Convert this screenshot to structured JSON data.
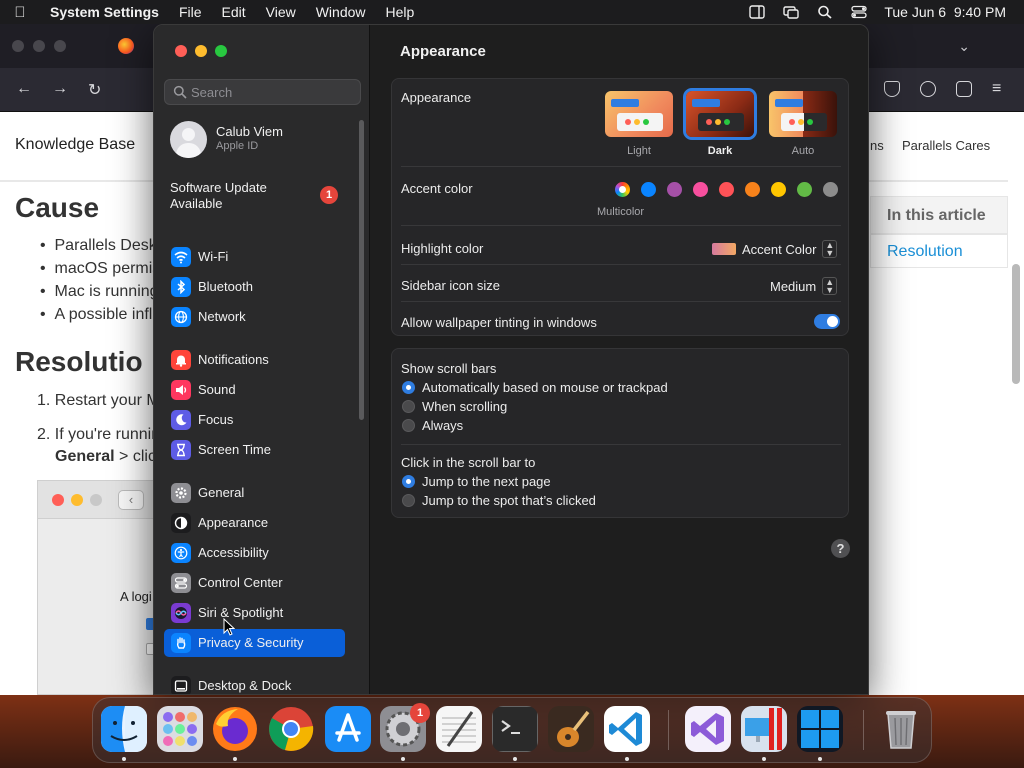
{
  "menubar": {
    "app": "System Settings",
    "menus": [
      "File",
      "Edit",
      "View",
      "Window",
      "Help"
    ],
    "clock": "Tue Jun 6  9:40 PM"
  },
  "browser": {
    "knowledge_base": "Knowledge Base",
    "top_link_partial": "ns",
    "top_link": "Parallels Cares",
    "heading_cause": "Cause",
    "bullets": [
      "Parallels Deskt",
      "macOS permis",
      "Mac is running",
      "A possible influ"
    ],
    "heading_resolution": "Resolutio",
    "steps": [
      "1. Restart your M",
      "2. If you're runnin"
    ],
    "step2_bold": "General",
    "step2_rest": " > clic",
    "in_this_article": "In this article",
    "resolution_link": "Resolution",
    "screenshot_text": "A logi"
  },
  "settings": {
    "search_placeholder": "Search",
    "account": {
      "name": "Calub Viem",
      "sub": "Apple ID"
    },
    "software_update": {
      "label": "Software Update Available",
      "badge": "1"
    },
    "sidebar_items": [
      {
        "label": "Wi-Fi",
        "icon": "wifi-icon",
        "color": "#0a84ff"
      },
      {
        "label": "Bluetooth",
        "icon": "bluetooth-icon",
        "color": "#0a84ff"
      },
      {
        "label": "Network",
        "icon": "globe-icon",
        "color": "#0a84ff"
      },
      {
        "label": "Notifications",
        "icon": "bell-icon",
        "color": "#ff453a"
      },
      {
        "label": "Sound",
        "icon": "speaker-icon",
        "color": "#ff375f"
      },
      {
        "label": "Focus",
        "icon": "moon-icon",
        "color": "#5e5ce6"
      },
      {
        "label": "Screen Time",
        "icon": "hourglass-icon",
        "color": "#5e5ce6"
      },
      {
        "label": "General",
        "icon": "gear-icon",
        "color": "#8e8e93"
      },
      {
        "label": "Appearance",
        "icon": "appearance-icon",
        "color": "#1c1c1e"
      },
      {
        "label": "Accessibility",
        "icon": "accessibility-icon",
        "color": "#0a84ff"
      },
      {
        "label": "Control Center",
        "icon": "control-center-icon",
        "color": "#8e8e93"
      },
      {
        "label": "Siri & Spotlight",
        "icon": "siri-icon",
        "color": "#7a3bd1"
      },
      {
        "label": "Privacy & Security",
        "icon": "hand-icon",
        "color": "#0a84ff"
      },
      {
        "label": "Desktop & Dock",
        "icon": "dock-icon",
        "color": "#1c1c1e"
      }
    ],
    "selected_item": "Privacy & Security",
    "title": "Appearance",
    "appearance": {
      "label": "Appearance",
      "options": [
        "Light",
        "Dark",
        "Auto"
      ],
      "selected": "Dark"
    },
    "accent": {
      "label": "Accent color",
      "colors": [
        "#0a84ff",
        "#a550a7",
        "#f74f9e",
        "#ff5257",
        "#f7821b",
        "#ffc600",
        "#62ba46",
        "#8c8c8c"
      ],
      "multicolor_label": "Multicolor"
    },
    "highlight": {
      "label": "Highlight color",
      "value": "Accent Color"
    },
    "sidebar_icon_size": {
      "label": "Sidebar icon size",
      "value": "Medium"
    },
    "wallpaper_tinting": {
      "label": "Allow wallpaper tinting in windows",
      "enabled": true
    },
    "scroll_bars": {
      "label": "Show scroll bars",
      "options": [
        "Automatically based on mouse or trackpad",
        "When scrolling",
        "Always"
      ],
      "selected": "Automatically based on mouse or trackpad"
    },
    "click_scroll": {
      "label": "Click in the scroll bar to",
      "options": [
        "Jump to the next page",
        "Jump to the spot that’s clicked"
      ],
      "selected": "Jump to the next page"
    },
    "help": "?"
  },
  "dock": {
    "apps": [
      "Finder",
      "Launchpad",
      "Firefox",
      "Chrome",
      "App Store",
      "System Settings",
      "TextEdit",
      "Terminal",
      "GarageBand",
      "Visual Studio Code",
      "Visual Studio",
      "Parallels Desktop",
      "Windows 11",
      "Trash"
    ],
    "settings_badge": "1"
  }
}
